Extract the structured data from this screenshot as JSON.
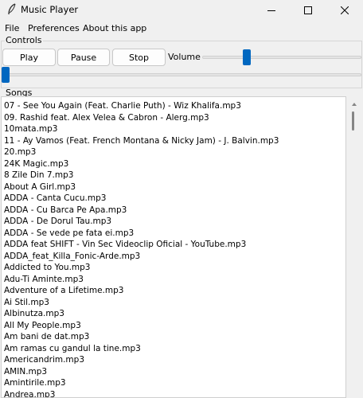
{
  "window": {
    "title": "Music Player"
  },
  "menu": {
    "items": [
      "File",
      "Preferences",
      "About this app"
    ]
  },
  "controls": {
    "group_label": "Controls",
    "play_label": "Play",
    "pause_label": "Pause",
    "stop_label": "Stop",
    "volume_label": "Volume",
    "volume_level": 0.27,
    "progress_level": 0.0
  },
  "songs": {
    "group_label": "Songs",
    "items": [
      "07 - See You Again (Feat. Charlie Puth) - Wiz Khalifa.mp3",
      "09. Rashid feat. Alex Velea & Cabron - Alerg.mp3",
      "10mata.mp3",
      "11 - Ay Vamos (Feat. French Montana & Nicky Jam) - J. Balvin.mp3",
      "20.mp3",
      "24K Magic.mp3",
      "8 Zile Din 7.mp3",
      "About A Girl.mp3",
      "ADDA - Canta Cucu.mp3",
      "ADDA - Cu Barca Pe Apa.mp3",
      "ADDA - De Dorul Tau.mp3",
      "ADDA - Se vede pe fata ei.mp3",
      "ADDA feat SHIFT - Vin Sec   Videoclip Oficial - YouTube.mp3",
      "ADDA_feat_Killa_Fonic-Arde.mp3",
      "Addicted to You.mp3",
      "Adu-Ti Aminte.mp3",
      "Adventure of a Lifetime.mp3",
      "Ai Stil.mp3",
      "Albinutza.mp3",
      "All My People.mp3",
      "Am bani de dat.mp3",
      "Am ramas cu gandul la tine.mp3",
      "Americandrim.mp3",
      "AMIN.mp3",
      "Amintirile.mp3",
      "Andrea.mp3"
    ]
  },
  "icons": {
    "app": "feather-icon",
    "minimize": "minimize-icon",
    "maximize": "maximize-icon",
    "close": "close-icon"
  },
  "colors": {
    "accent": "#0067c0",
    "background": "#f0f0f0",
    "list_background": "#ffffff"
  }
}
